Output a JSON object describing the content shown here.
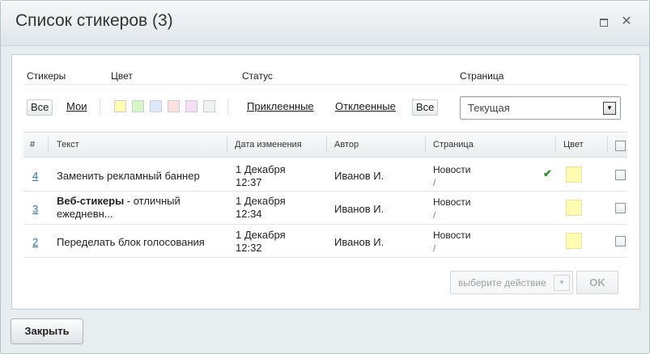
{
  "window": {
    "title": "Список стикеров (3)"
  },
  "filters": {
    "labels": {
      "stickers": "Стикеры",
      "color": "Цвет",
      "status": "Статус",
      "page": "Страница"
    },
    "stickers_all": "Все",
    "stickers_mine": "Мои",
    "swatches": [
      "#fffbb0",
      "#d8f7c6",
      "#dbe7fb",
      "#fbe1e1",
      "#f7dcf7",
      "#f1f1f1"
    ],
    "status_attached": "Приклеенные",
    "status_detached": "Отклеенные",
    "status_all": "Все",
    "page_select": {
      "value": "Текущая"
    }
  },
  "table": {
    "headers": {
      "num": "#",
      "text": "Текст",
      "date": "Дата изменения",
      "author": "Автор",
      "page": "Страница",
      "color": "Цвет"
    },
    "rows": [
      {
        "num": "4",
        "text_bold": "",
        "text": "Заменить рекламный баннер",
        "date_day": "1 Декабря",
        "date_time": "12:37",
        "author": "Иванов И.",
        "page": "Новости",
        "page_sub": "/",
        "color": "#fffbb0",
        "attached": true
      },
      {
        "num": "3",
        "text_bold": "Веб-стикеры",
        "text": " - отличный ежедневн...",
        "date_day": "1 Декабря",
        "date_time": "12:34",
        "author": "Иванов И.",
        "page": "Новости",
        "page_sub": "/",
        "color": "#fffbb0",
        "attached": false
      },
      {
        "num": "2",
        "text_bold": "",
        "text": "Переделать блок голосования",
        "date_day": "1 Декабря",
        "date_time": "12:32",
        "author": "Иванов И.",
        "page": "Новости",
        "page_sub": "/",
        "color": "#fffbb0",
        "attached": false
      }
    ]
  },
  "actions": {
    "select_placeholder": "выберите действие",
    "ok_label": "OK"
  },
  "footer": {
    "close_label": "Закрыть"
  }
}
